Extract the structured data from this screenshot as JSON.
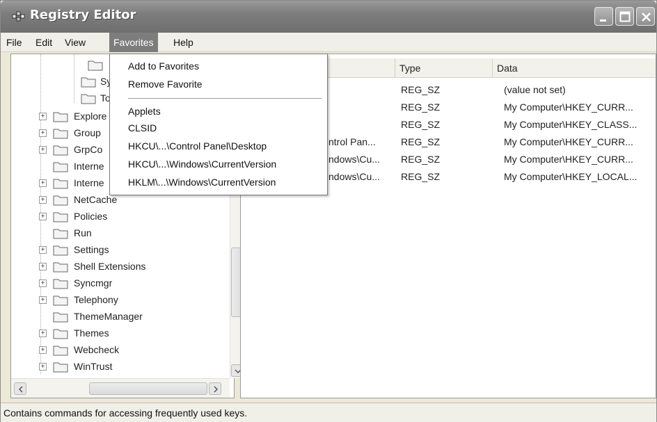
{
  "window": {
    "title": "Registry Editor"
  },
  "menubar": {
    "items": [
      {
        "label": "File"
      },
      {
        "label": "Edit"
      },
      {
        "label": "View"
      },
      {
        "label": "Favorites"
      },
      {
        "label": "Help"
      }
    ],
    "active_item": "Favorites"
  },
  "favorites_menu": {
    "items": [
      {
        "label": "Add to Favorites"
      },
      {
        "label": "Remove Favorite"
      },
      {
        "label": "Applets"
      },
      {
        "label": "CLSID"
      },
      {
        "label": "HKCU\\...\\Control Panel\\Desktop"
      },
      {
        "label": "HKCU\\...\\Windows\\CurrentVersion"
      },
      {
        "label": "HKLM\\...\\Windows\\CurrentVersion"
      }
    ]
  },
  "tree": {
    "items": [
      {
        "label": "",
        "expander": false
      },
      {
        "label": "Sy",
        "expander": false
      },
      {
        "label": "To",
        "expander": false
      },
      {
        "label": "Explore",
        "expander": true
      },
      {
        "label": "Group",
        "expander": true
      },
      {
        "label": "GrpCo",
        "expander": true
      },
      {
        "label": "Interne",
        "expander": false
      },
      {
        "label": "Interne",
        "expander": true
      },
      {
        "label": "NetCache",
        "expander": true
      },
      {
        "label": "Policies",
        "expander": true
      },
      {
        "label": "Run",
        "expander": false
      },
      {
        "label": "Settings",
        "expander": true
      },
      {
        "label": "Shell Extensions",
        "expander": true
      },
      {
        "label": "Syncmgr",
        "expander": true
      },
      {
        "label": "Telephony",
        "expander": true
      },
      {
        "label": "ThemeManager",
        "expander": false
      },
      {
        "label": "Themes",
        "expander": true
      },
      {
        "label": "Webcheck",
        "expander": true
      },
      {
        "label": "WinTrust",
        "expander": true
      }
    ]
  },
  "list": {
    "columns": [
      {
        "label": ""
      },
      {
        "label": "Type"
      },
      {
        "label": "Data"
      }
    ],
    "rows": [
      {
        "name": "",
        "type": "REG_SZ",
        "data": "(value not set)"
      },
      {
        "name": "",
        "type": "REG_SZ",
        "data": "My Computer\\HKEY_CURR..."
      },
      {
        "name": "",
        "type": "REG_SZ",
        "data": "My Computer\\HKEY_CLASS..."
      },
      {
        "name": "ntrol Pan...",
        "type": "REG_SZ",
        "data": "My Computer\\HKEY_CURR..."
      },
      {
        "name": "ndows\\Cu...",
        "type": "REG_SZ",
        "data": "My Computer\\HKEY_CURR..."
      },
      {
        "name": "ndows\\Cu...",
        "type": "REG_SZ",
        "data": "My Computer\\HKEY_LOCAL..."
      }
    ]
  },
  "statusbar": {
    "text": "Contains commands for accessing frequently used keys."
  },
  "icons": {
    "app": "registry-editor-icon",
    "folder": "folder-icon",
    "expand": "plus-expander-icon",
    "minimize": "minimize-icon",
    "maximize": "maximize-icon",
    "close": "close-icon"
  },
  "colors": {
    "titlebar": "#7d7d7d",
    "menu_active": "#7d7d7d",
    "window_bg": "#ece9d8"
  }
}
